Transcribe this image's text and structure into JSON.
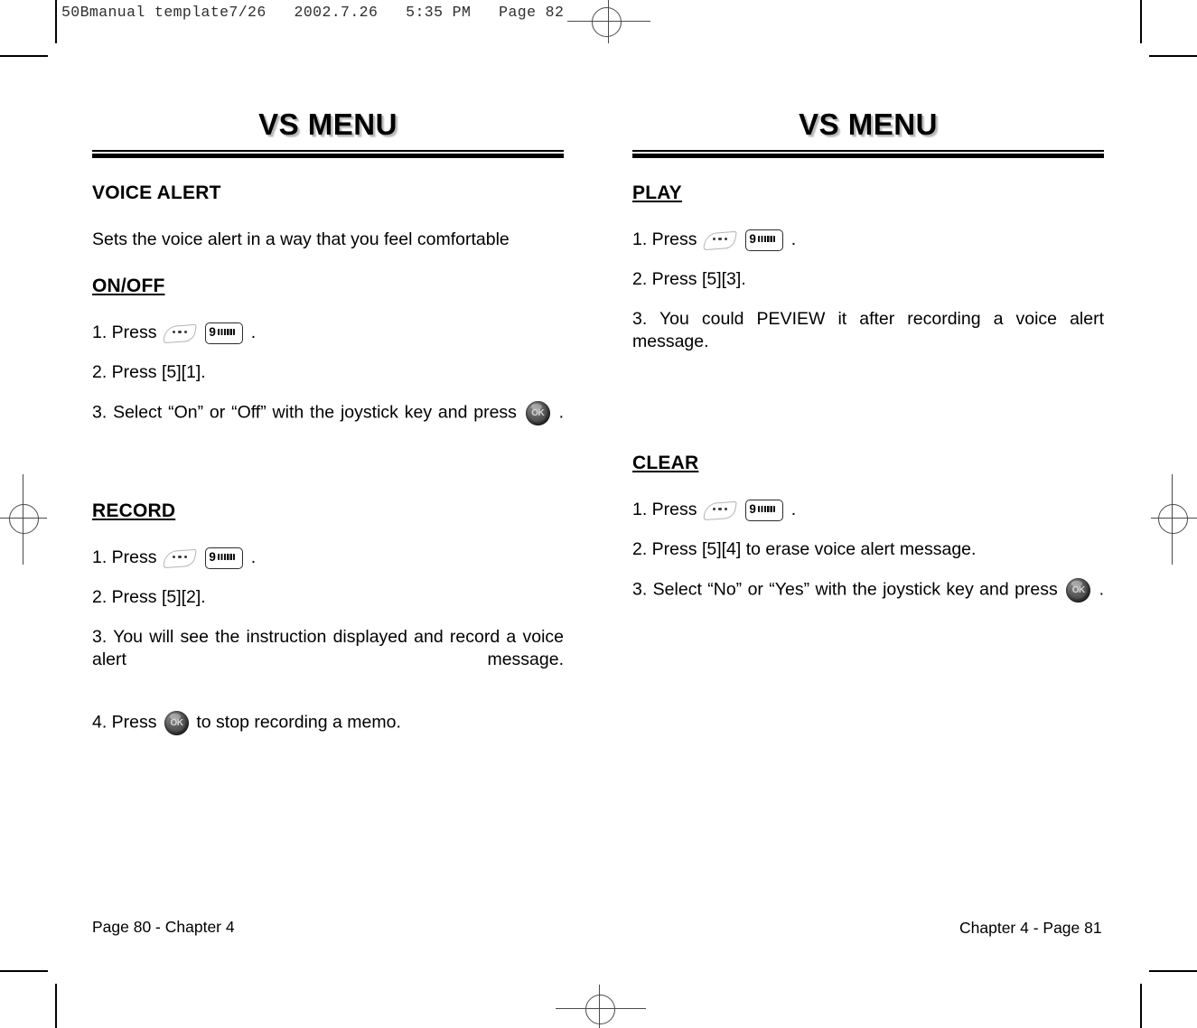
{
  "scan_header": "50Bmanual template7/26   2002.7.26   5:35 PM   Page 82",
  "banner": {
    "left_title": "VS MENU",
    "right_title": "VS MENU"
  },
  "icons": {
    "softkey": "softkey-menu-icon",
    "numkey_digit": "9",
    "numkey_letters": "wxyz",
    "joystick_label": "OK"
  },
  "left_column": {
    "heading": "VOICE ALERT",
    "intro": "Sets the voice alert in a way that you feel comfortable",
    "onoff": {
      "title": "ON/OFF",
      "step1_prefix": "1. Press",
      "step1_suffix": ".",
      "step2": "2. Press [5][1].",
      "step3_prefix": "3. Select “On” or “Off” with the joystick key  and press",
      "step3_suffix": "."
    },
    "record": {
      "title": "RECORD",
      "step1_prefix": "1. Press",
      "step1_suffix": ".",
      "step2": "2. Press [5][2].",
      "step3": "3. You will see the instruction displayed and record a voice alert message.",
      "step4_prefix": "4. Press",
      "step4_suffix": "to stop recording a memo."
    }
  },
  "right_column": {
    "play": {
      "title": "PLAY",
      "step1_prefix": "1. Press",
      "step1_suffix": ".",
      "step2": "2. Press [5][3].",
      "step3": "3. You could PEVIEW it after recording a voice alert message."
    },
    "clear": {
      "title": "CLEAR",
      "step1_prefix": "1. Press",
      "step1_suffix": ".",
      "step2": "2. Press [5][4] to erase voice alert message.",
      "step3_prefix": "3. Select “No” or “Yes” with the joystick key  and press",
      "step3_suffix": "."
    }
  },
  "footer": {
    "left": "Page 80 - Chapter 4",
    "right": "Chapter 4 - Page 81"
  }
}
